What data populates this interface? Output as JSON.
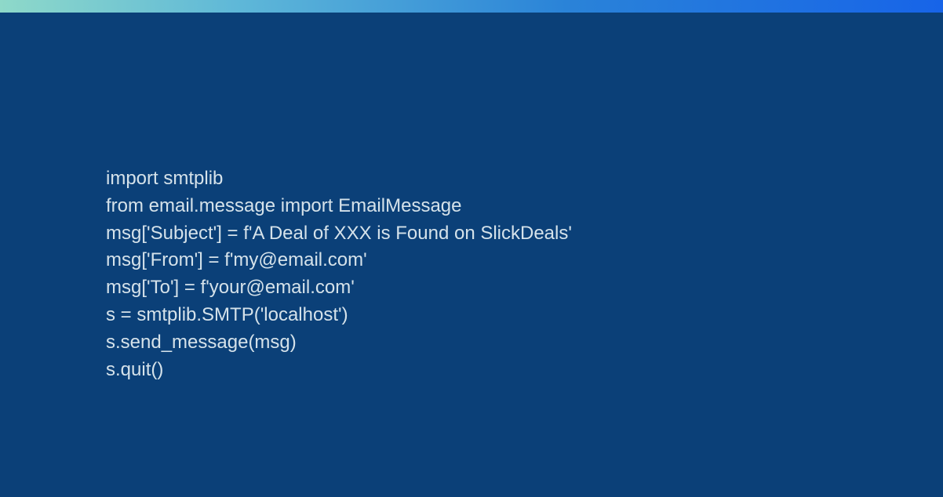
{
  "code": {
    "lines": [
      "import smtplib",
      "from email.message import EmailMessage",
      "msg['Subject'] = f'A Deal of XXX is Found on SlickDeals'",
      "msg['From'] = f'my@email.com'",
      "msg['To'] = f'your@email.com'",
      "s = smtplib.SMTP('localhost')",
      "s.send_message(msg)",
      "s.quit()"
    ]
  }
}
